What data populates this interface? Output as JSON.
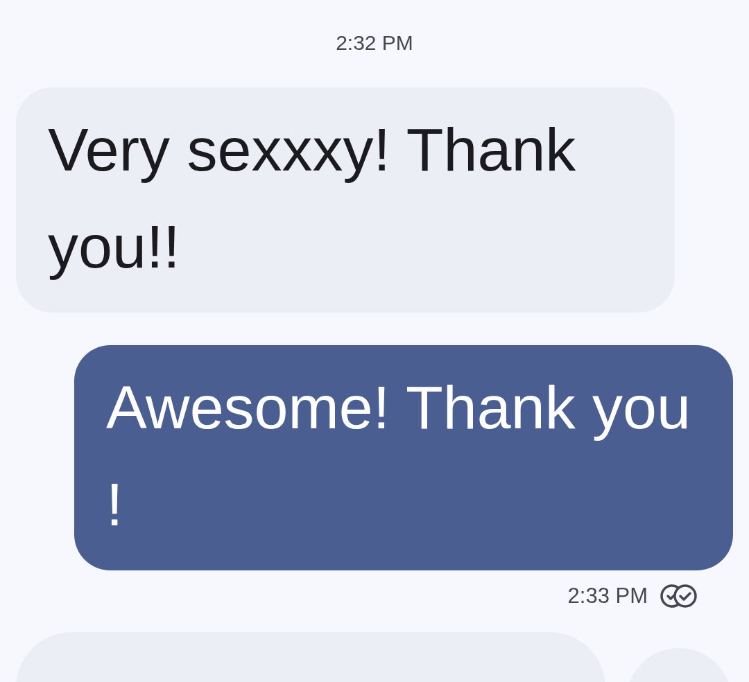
{
  "timestamp": "2:32 PM",
  "messages": [
    {
      "kind": "incoming",
      "text": "Very sexxxy! Thank you!!"
    },
    {
      "kind": "outgoing",
      "text": "Awesome! Thank you !",
      "time": "2:33 PM",
      "read": true
    }
  ]
}
